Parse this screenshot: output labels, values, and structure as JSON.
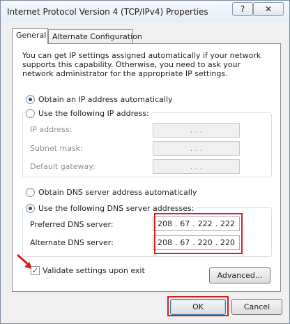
{
  "window": {
    "title": "Internet Protocol Version 4 (TCP/IPv4) Properties",
    "help_label": "?",
    "close_label": "✕"
  },
  "tabs": [
    {
      "label": "General",
      "active": true
    },
    {
      "label": "Alternate Configuration",
      "active": false
    }
  ],
  "description": "You can get IP settings assigned automatically if your network supports this capability. Otherwise, you need to ask your network administrator for the appropriate IP settings.",
  "ip_settings": {
    "auto_label": "Obtain an IP address automatically",
    "auto_selected": true,
    "manual_label": "Use the following IP address:",
    "fields": [
      {
        "label": "IP address:",
        "value": ".   .   ."
      },
      {
        "label": "Subnet mask:",
        "value": ".   .   ."
      },
      {
        "label": "Default gateway:",
        "value": ".   .   ."
      }
    ]
  },
  "dns_settings": {
    "auto_label": "Obtain DNS server address automatically",
    "manual_label": "Use the following DNS server addresses:",
    "manual_selected": true,
    "preferred": {
      "label": "Preferred DNS server:",
      "octets": [
        "208",
        "67",
        "222",
        "222"
      ]
    },
    "alternate": {
      "label": "Alternate DNS server:",
      "octets": [
        "208",
        "67",
        "220",
        "220"
      ]
    }
  },
  "validate": {
    "label": "Validate settings upon exit",
    "checked": true
  },
  "buttons": {
    "advanced": "Advanced...",
    "ok": "OK",
    "cancel": "Cancel"
  },
  "colors": {
    "highlight": "#d42020",
    "accent": "#24507c"
  }
}
